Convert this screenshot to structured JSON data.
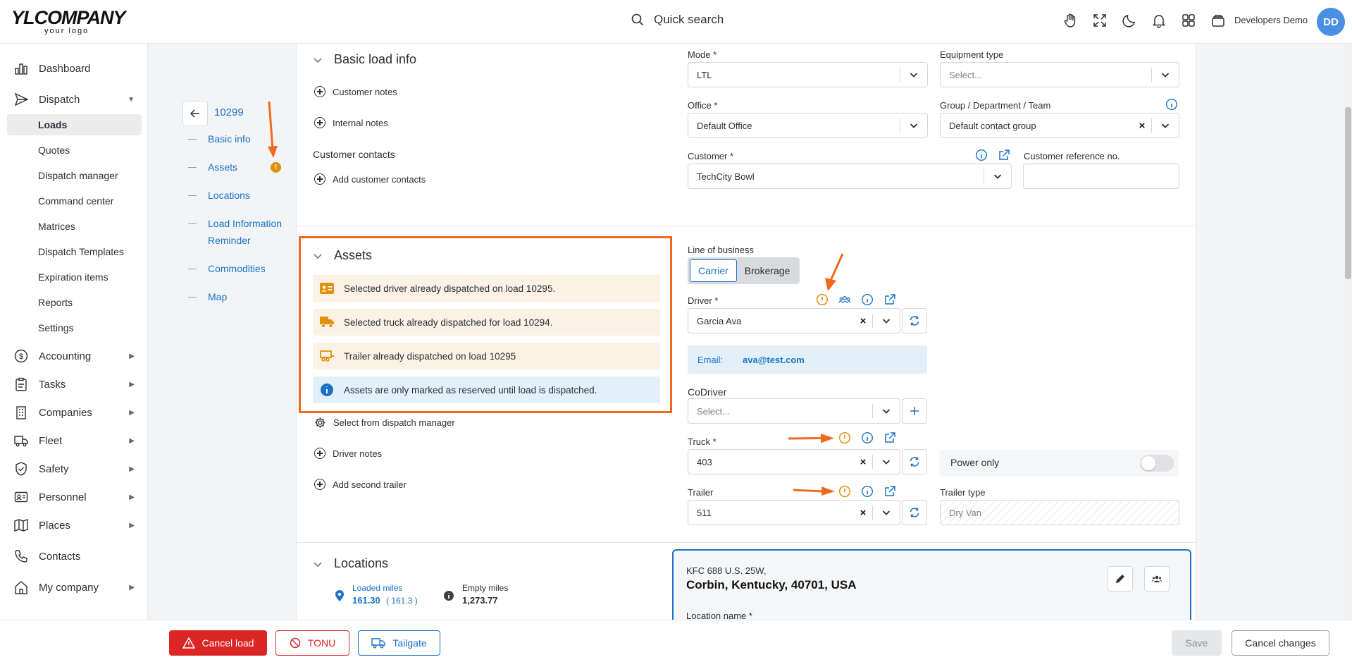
{
  "header": {
    "logo_main": "YLCOMPANY",
    "logo_sub": "your logo",
    "search_label": "Quick search",
    "user_name": "Developers Demo",
    "avatar_initials": "DD"
  },
  "sidebar": {
    "items": [
      {
        "label": "Dashboard"
      },
      {
        "label": "Dispatch"
      },
      {
        "label": "Accounting"
      },
      {
        "label": "Tasks"
      },
      {
        "label": "Companies"
      },
      {
        "label": "Fleet"
      },
      {
        "label": "Safety"
      },
      {
        "label": "Personnel"
      },
      {
        "label": "Places"
      },
      {
        "label": "Contacts"
      },
      {
        "label": "My company"
      }
    ],
    "dispatch_sub": [
      "Loads",
      "Quotes",
      "Dispatch manager",
      "Command center",
      "Matrices",
      "Dispatch Templates",
      "Expiration items",
      "Reports",
      "Settings"
    ]
  },
  "section_nav": {
    "load_id": "10299",
    "links": [
      "Basic info",
      "Assets",
      "Locations",
      "Load Information",
      "Reminder",
      "Commodities",
      "Map"
    ],
    "assets_warn": "!"
  },
  "basic": {
    "title": "Basic load info",
    "customer_notes": "Customer notes",
    "internal_notes": "Internal notes",
    "customer_contacts": "Customer contacts",
    "add_contacts": "Add customer contacts",
    "mode_label": "Mode *",
    "mode_value": "LTL",
    "equipment_label": "Equipment type",
    "equipment_placeholder": "Select...",
    "office_label": "Office *",
    "office_value": "Default Office",
    "group_label": "Group / Department / Team",
    "group_value": "Default contact group",
    "customer_label": "Customer *",
    "customer_value": "TechCity Bowl",
    "ref_label": "Customer reference no."
  },
  "assets": {
    "title": "Assets",
    "alerts": [
      "Selected driver already dispatched on load 10295.",
      "Selected truck already dispatched for load 10294.",
      "Trailer already dispatched on load 10295",
      "Assets are only marked as reserved until load is dispatched."
    ],
    "select_dm": "Select from dispatch manager",
    "driver_notes": "Driver notes",
    "add_trailer": "Add second trailer",
    "lob_label": "Line of business",
    "lob_options": [
      "Carrier",
      "Brokerage"
    ],
    "driver_label": "Driver *",
    "driver_value": "Garcia Ava",
    "email_key": "Email:",
    "email_value": "ava@test.com",
    "codriver_label": "CoDriver",
    "codriver_placeholder": "Select...",
    "truck_label": "Truck *",
    "truck_value": "403",
    "power_only": "Power only",
    "trailer_label": "Trailer",
    "trailer_value": "511",
    "trailer_type_label": "Trailer type",
    "trailer_type_value": "Dry Van",
    "clear_glyph": "×"
  },
  "locations": {
    "title": "Locations",
    "loaded_label": "Loaded miles",
    "loaded_value": "161.30",
    "loaded_paren": "( 161.3 )",
    "empty_label": "Empty miles",
    "empty_value": "1,273.77",
    "addr_line1": "KFC 688 U.S. 25W,",
    "addr_line2": "Corbin, Kentucky, 40701, USA",
    "location_name_label": "Location name *"
  },
  "footer": {
    "cancel_load": "Cancel load",
    "tonu": "TONU",
    "tailgate": "Tailgate",
    "save": "Save",
    "cancel_changes": "Cancel changes"
  },
  "colors": {
    "accent": "#1a73c8",
    "danger": "#dc2626",
    "warning": "#e0900f",
    "highlight": "#f06a1e"
  }
}
